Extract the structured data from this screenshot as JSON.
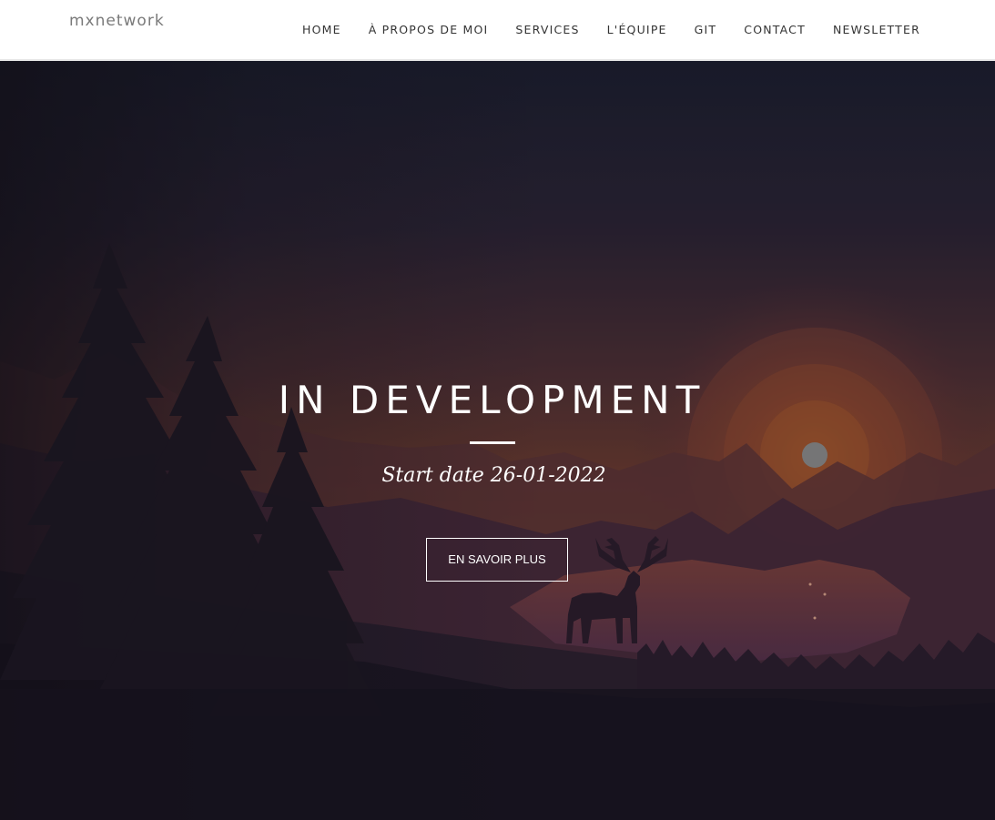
{
  "navbar": {
    "brand": "mxnetwork",
    "links": [
      "HOME",
      "À PROPOS DE MOI",
      "SERVICES",
      "L'ÉQUIPE",
      "GIT",
      "CONTACT",
      "NEWSLETTER"
    ]
  },
  "hero": {
    "title": "IN DEVELOPMENT",
    "subtitle": "Start date 26-01-2022",
    "button_label": "EN SAVOIR PLUS",
    "background_image": "sunset-mountain-lake-deer-illustration"
  },
  "colors": {
    "navbar_bg": "#ffffff",
    "nav_text": "#333333",
    "brand_text": "#7a7a7a",
    "hero_text": "#ffffff"
  }
}
